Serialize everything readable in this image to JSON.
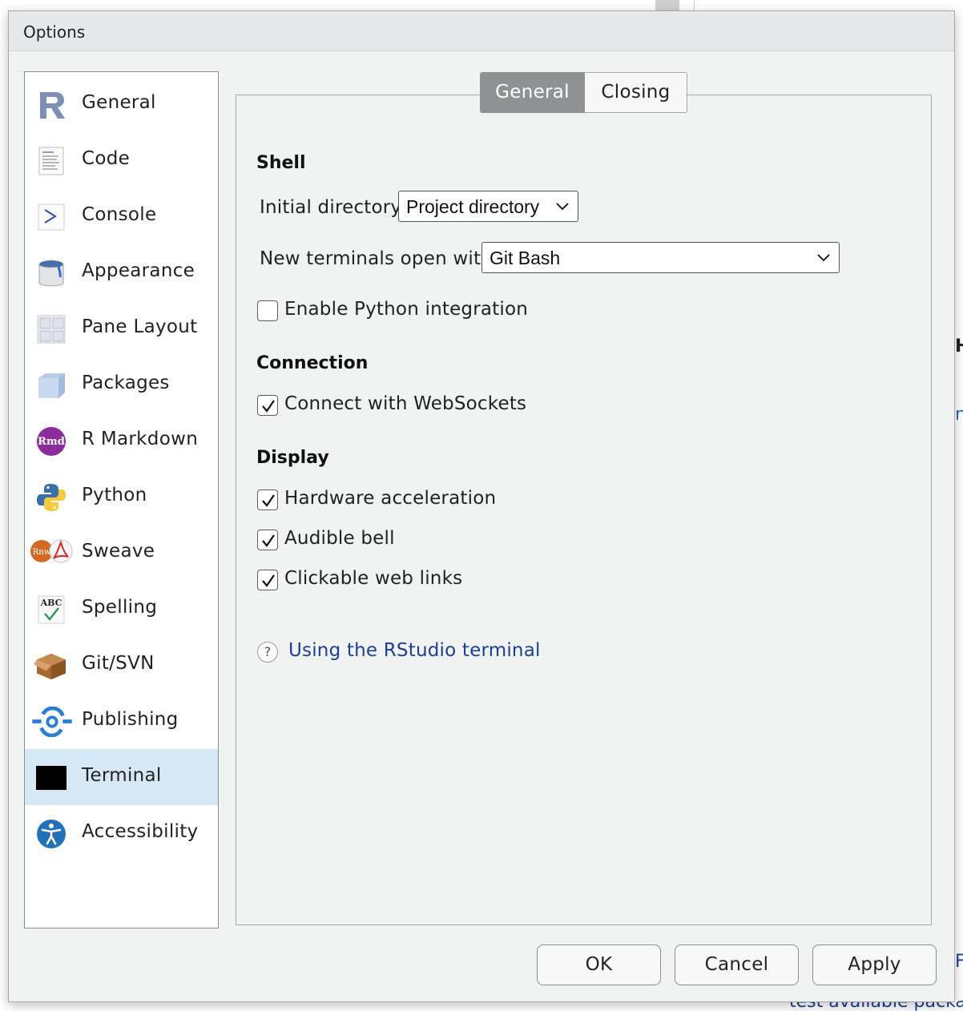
{
  "window": {
    "title": "Options"
  },
  "sidebar": {
    "items": [
      {
        "label": "General",
        "icon": "r-logo-icon"
      },
      {
        "label": "Code",
        "icon": "code-document-icon"
      },
      {
        "label": "Console",
        "icon": "console-prompt-icon"
      },
      {
        "label": "Appearance",
        "icon": "paint-bucket-icon"
      },
      {
        "label": "Pane Layout",
        "icon": "pane-grid-icon"
      },
      {
        "label": "Packages",
        "icon": "package-cube-icon"
      },
      {
        "label": "R Markdown",
        "icon": "rmd-icon",
        "badge": "Rmd"
      },
      {
        "label": "Python",
        "icon": "python-logo-icon"
      },
      {
        "label": "Sweave",
        "icon": "sweave-pdf-icon",
        "badge": "Rnw"
      },
      {
        "label": "Spelling",
        "icon": "spellcheck-icon",
        "badge": "ABC"
      },
      {
        "label": "Git/SVN",
        "icon": "git-box-icon"
      },
      {
        "label": "Publishing",
        "icon": "publishing-icon"
      },
      {
        "label": "Terminal",
        "icon": "terminal-icon",
        "selected": true
      },
      {
        "label": "Accessibility",
        "icon": "accessibility-icon"
      }
    ]
  },
  "tabs": {
    "general": "General",
    "closing": "Closing",
    "active": "General"
  },
  "shell": {
    "title": "Shell",
    "initial_directory_label": "Initial directory:",
    "initial_directory_value": "Project directory",
    "new_terminals_label": "New terminals open with:",
    "new_terminals_value": "Git Bash",
    "python_integration_label": "Enable Python integration",
    "python_integration_checked": false
  },
  "connection": {
    "title": "Connection",
    "websockets_label": "Connect with WebSockets",
    "websockets_checked": true
  },
  "display": {
    "title": "Display",
    "hardware_accel_label": "Hardware acceleration",
    "hardware_accel_checked": true,
    "audible_bell_label": "Audible bell",
    "audible_bell_checked": true,
    "clickable_links_label": "Clickable web links",
    "clickable_links_checked": true
  },
  "help": {
    "link_text": "Using the RStudio terminal",
    "icon_glyph": "?"
  },
  "buttons": {
    "ok": "OK",
    "cancel": "Cancel",
    "apply": "Apply"
  },
  "background": {
    "fragment_bottom": "test available packa",
    "fragment_right_a": "H",
    "fragment_right_b": "n",
    "fragment_right_c": "F"
  },
  "colors": {
    "selection": "#d6e7f5",
    "tab_active": "#909192",
    "link": "#1c3f94",
    "dialog_bg": "#f1f2f2"
  }
}
